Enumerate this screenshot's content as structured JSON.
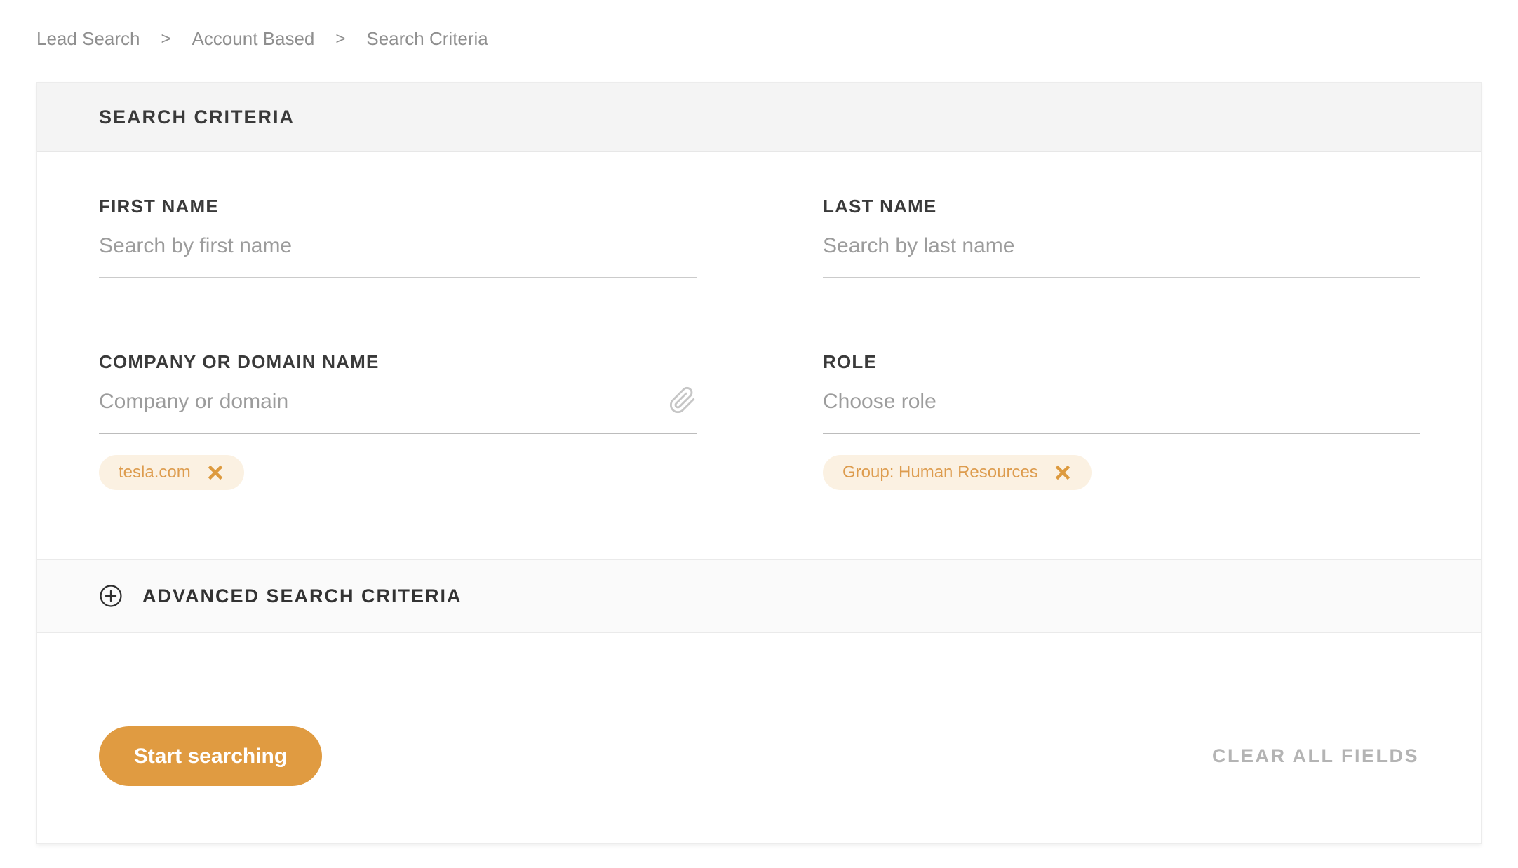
{
  "breadcrumb": {
    "separator": ">",
    "items": [
      {
        "label": "Lead Search"
      },
      {
        "label": "Account Based"
      },
      {
        "label": "Search Criteria"
      }
    ]
  },
  "panel": {
    "header_title": "SEARCH CRITERIA",
    "fields": {
      "first_name": {
        "label": "FIRST NAME",
        "placeholder": "Search by first name",
        "value": ""
      },
      "last_name": {
        "label": "LAST NAME",
        "placeholder": "Search by last name",
        "value": ""
      },
      "company": {
        "label": "COMPANY OR DOMAIN NAME",
        "placeholder": "Company or domain",
        "value": "",
        "tags": [
          {
            "label": "tesla.com"
          }
        ]
      },
      "role": {
        "label": "ROLE",
        "placeholder": "Choose role",
        "value": "",
        "tags": [
          {
            "label": "Group: Human Resources"
          }
        ]
      }
    },
    "advanced": {
      "label": "ADVANCED SEARCH CRITERIA"
    },
    "footer": {
      "start_button_label": "Start searching",
      "clear_button_label": "CLEAR ALL FIELDS"
    }
  },
  "icons": {
    "paperclip": "paperclip-attach",
    "plus_circle": "expand-plus-circle",
    "tag_close": "remove-x"
  },
  "colors": {
    "accent_orange": "#e09b41",
    "tag_background": "#fbf1e2",
    "tag_text": "#dd9c4e",
    "tag_x": "#dd9a3e",
    "header_band": "#f4f4f4",
    "advanced_band": "#fafafa",
    "label_text": "#3a3a3a",
    "placeholder_text": "#9c9c9c",
    "breadcrumb_text": "#8f8f8f",
    "clear_text": "#b4b4b4"
  }
}
